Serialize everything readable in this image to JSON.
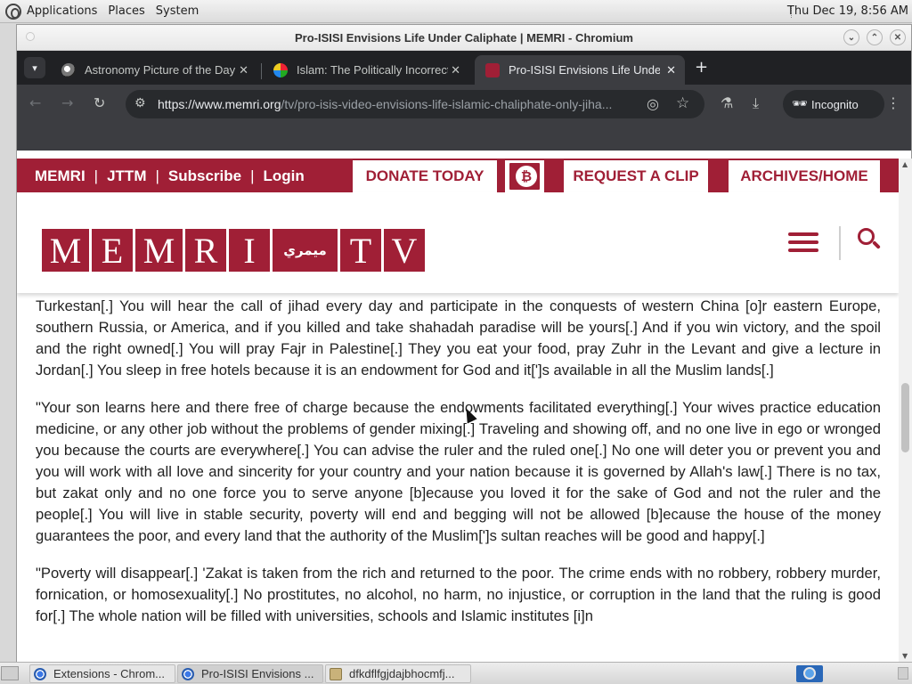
{
  "desktop": {
    "menus": [
      "Applications",
      "Places",
      "System"
    ],
    "clock": "Thu Dec 19,  8:56 AM"
  },
  "window": {
    "title": "Pro-ISISI Envisions Life Under Caliphate | MEMRI - Chromium"
  },
  "tabs": [
    {
      "label": "Astronomy Picture of the Day",
      "active": false
    },
    {
      "label": "Islam: The Politically Incorrect",
      "active": false
    },
    {
      "label": "Pro-ISISI Envisions Life Under Caliphate",
      "active": true
    }
  ],
  "toolbar": {
    "url_main": "https://www.memri.org",
    "url_rest": "/tv/pro-isis-video-envisions-life-islamic-chaliphate-only-jiha...",
    "incognito_label": "Incognito"
  },
  "site_nav": {
    "left_links": [
      "MEMRI",
      "JTTM",
      "Subscribe",
      "Login"
    ],
    "separator": "|",
    "donate": "DONATE TODAY",
    "request_clip": "REQUEST A CLIP",
    "archives": "ARCHIVES/HOME",
    "bitcoin_symbol": "₿"
  },
  "logo": {
    "letters": [
      "M",
      "E",
      "M",
      "R",
      "I"
    ],
    "arabic": "ميمري",
    "tv_letters": [
      "T",
      "V"
    ]
  },
  "article": {
    "paragraphs": [
      "Turkestan[.] You will hear the call of jihad every day and participate in the conquests of western China [o]r eastern Europe, southern Russia, or America, and if you killed and take shahadah paradise will be yours[.] And if you win victory, and the spoil and the right owned[.] You will pray Fajr in Palestine[.] They you eat your food, pray Zuhr in the Levant and give a lecture in Jordan[.] You sleep in free hotels because it is an endowment for God and it[']s available in all the Muslim lands[.]",
      "\"Your son learns here and there free of charge because the endowments facilitated everything[.] Your wives practice education medicine, or any other job without the problems of gender mixing[.] Traveling and showing off, and no one live in ego or wronged you because the courts are everywhere[.] You can advise the ruler and the ruled one[.] No one will deter you or prevent you and you will work with all love and sincerity for your country and your nation because it is governed by Allah's law[.] There is no tax, but zakat only and no one force you to serve anyone [b]ecause you loved it for the sake of God and not the ruler and the people[.] You will live in stable security, poverty will end and begging will not be allowed [b]ecause the house of the money guarantees the poor, and every land that the authority of the Muslim[']s sultan reaches will be good and happy[.]",
      "\"Poverty will disappear[.] 'Zakat is taken from the rich and returned to the poor. The crime ends with no robbery, robbery murder, fornication, or homosexuality[.] No prostitutes, no alcohol, no harm, no injustice, or corruption in the land that the ruling is good for[.] The whole nation will be filled with universities, schools and Islamic institutes [i]n"
    ]
  },
  "taskbar": {
    "items": [
      {
        "label": "Extensions - Chrom..."
      },
      {
        "label": "Pro-ISISI Envisions ..."
      },
      {
        "label": "dfkdflfgjdajbhocmfj..."
      }
    ]
  },
  "colors": {
    "brand": "#a01f36",
    "browser_dark": "#202124",
    "toolbar": "#3c3d41"
  }
}
